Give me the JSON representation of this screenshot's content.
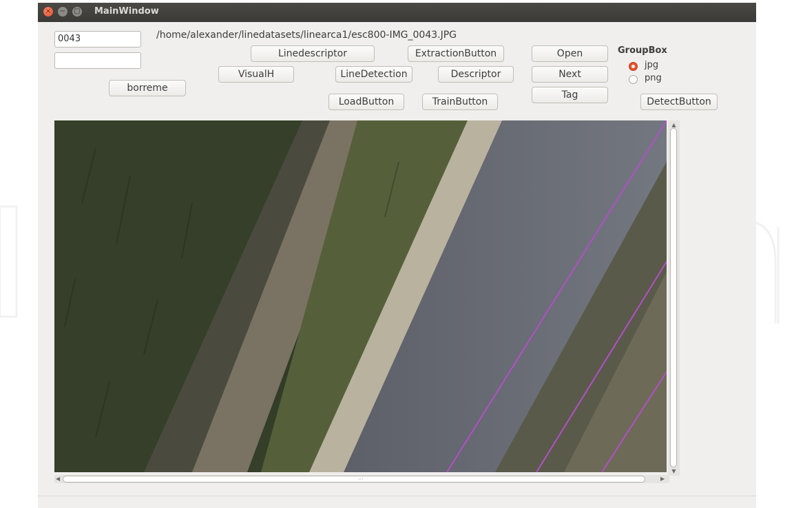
{
  "window": {
    "title": "MainWindow",
    "controls": [
      "close-icon",
      "minimize-icon",
      "maximize-icon"
    ]
  },
  "fields": {
    "number_value": "0043",
    "second_value": ""
  },
  "path_label": "/home/alexander/linedatasets/linearca1/esc800-IMG_0043.JPG",
  "buttons": {
    "borreme": "borreme",
    "linedescriptor": "Linedescriptor",
    "visualh": "VisualH",
    "linedetection": "LineDetection",
    "extraction": "ExtractionButton",
    "descriptor": "Descriptor",
    "load": "LoadButton",
    "train": "TrainButton",
    "open": "Open",
    "next": "Next",
    "tag": "Tag",
    "detect": "DetectButton"
  },
  "groupbox": {
    "title": "GroupBox",
    "options": [
      {
        "label": "jpg",
        "selected": true
      },
      {
        "label": "png",
        "selected": false
      }
    ]
  },
  "image_view": {
    "content": "aerial-road-image",
    "overlay_line_color": "#b24fc8"
  },
  "colors": {
    "titlebar": "#3c3b37",
    "window_bg": "#f0efee",
    "radio_accent": "#e6502a"
  }
}
